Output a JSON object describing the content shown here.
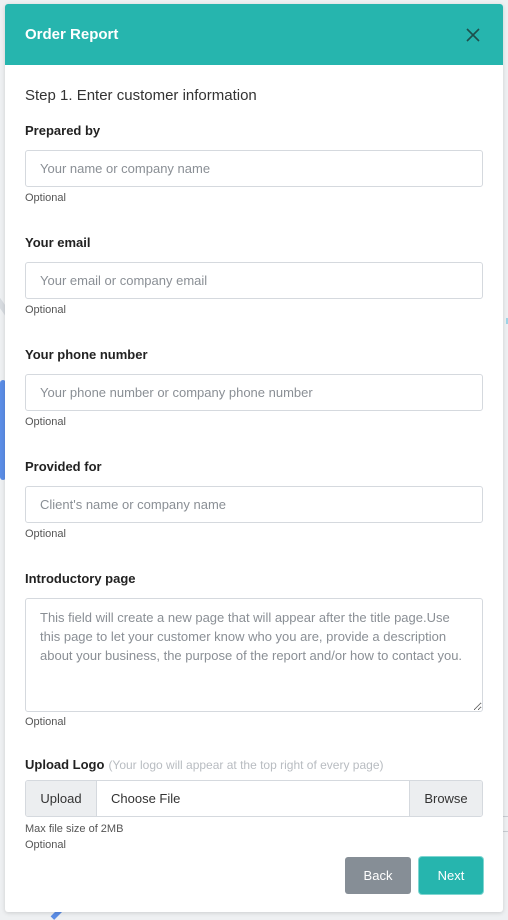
{
  "modal": {
    "title": "Order Report",
    "close_icon": "close-icon"
  },
  "step_title": "Step 1. Enter customer information",
  "fields": [
    {
      "label": "Prepared by",
      "placeholder": "Your name or company name",
      "value": "",
      "hint": "Optional"
    },
    {
      "label": "Your email",
      "placeholder": "Your email or company email",
      "value": "",
      "hint": "Optional"
    },
    {
      "label": "Your phone number",
      "placeholder": "Your phone number or company phone number",
      "value": "",
      "hint": "Optional"
    },
    {
      "label": "Provided for",
      "placeholder": "Client's name or company name",
      "value": "",
      "hint": "Optional"
    }
  ],
  "intro": {
    "label": "Introductory page",
    "placeholder": "This field will create a new page that will appear after the title page.Use this page to let your customer know who you are, provide a description about your business, the purpose of the report and/or how to contact you.",
    "hint": "Optional"
  },
  "upload": {
    "label": "Upload Logo",
    "note": "(Your logo will appear at the top right of every page)",
    "prefix": "Upload",
    "choose_label": "Choose File",
    "browse_label": "Browse",
    "size_hint": "Max file size of 2MB",
    "hint": "Optional"
  },
  "footer": {
    "back_label": "Back",
    "next_label": "Next"
  },
  "colors": {
    "accent": "#26b5ae",
    "back_button": "#868e96"
  }
}
